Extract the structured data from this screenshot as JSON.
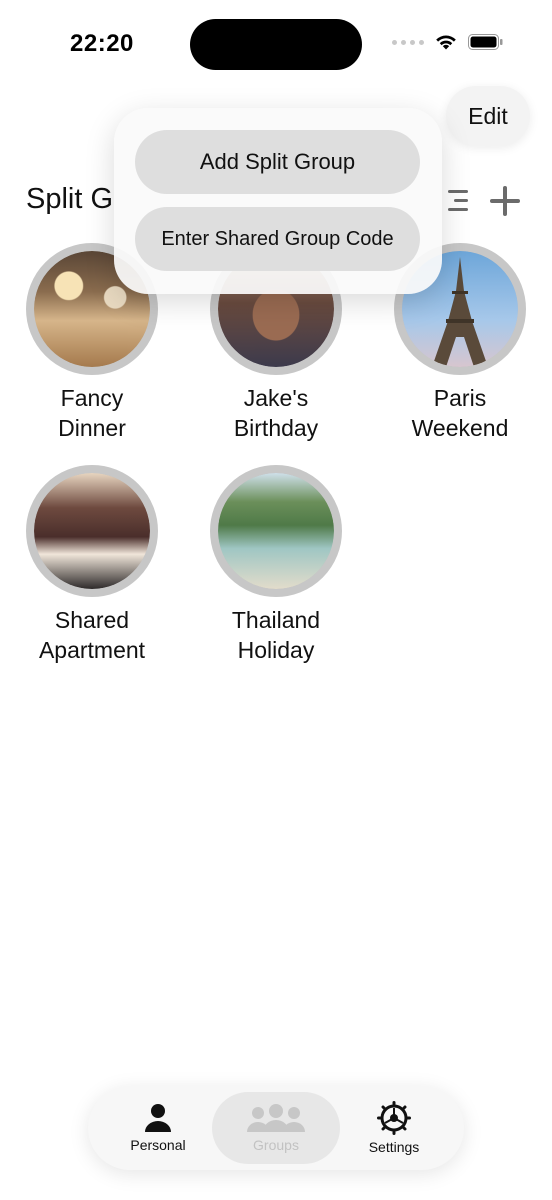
{
  "status_bar": {
    "time": "22:20"
  },
  "header": {
    "edit_label": "Edit",
    "title": "Split G"
  },
  "menu": {
    "items": [
      {
        "label": "Add Split Group"
      },
      {
        "label": "Enter Shared Group Code"
      }
    ]
  },
  "groups": [
    {
      "name": "Fancy\nDinner",
      "photo": "restaurant-table-photo"
    },
    {
      "name": "Jake's\nBirthday",
      "photo": "gift-box-photo"
    },
    {
      "name": "Paris\nWeekend",
      "photo": "eiffel-tower-photo"
    },
    {
      "name": "Shared\nApartment",
      "photo": "living-room-photo"
    },
    {
      "name": "Thailand\nHoliday",
      "photo": "boats-beach-photo"
    }
  ],
  "tabbar": {
    "tabs": [
      {
        "label": "Personal",
        "icon": "person-icon"
      },
      {
        "label": "Groups",
        "icon": "group-icon",
        "selected": true
      },
      {
        "label": "Settings",
        "icon": "gear-icon"
      }
    ]
  }
}
